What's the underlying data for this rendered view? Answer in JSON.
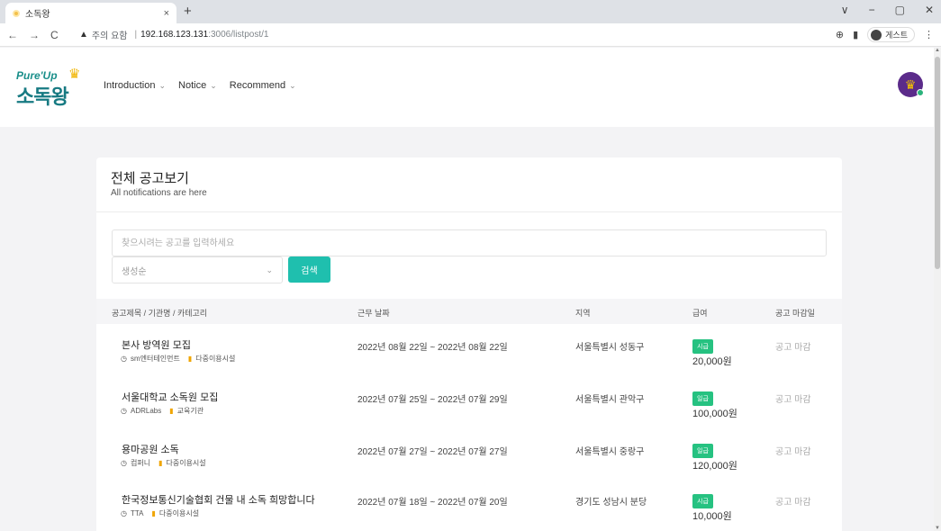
{
  "browser": {
    "tab_title": "소독왕",
    "tab_close": "×",
    "new_tab": "+",
    "nav": {
      "back": "←",
      "forward": "→",
      "reload": "C"
    },
    "address": {
      "warning": "▲",
      "insecure_label": "주의 요함",
      "separator": "|",
      "host": "192.168.123.131",
      "path": ":3006/listpost/1"
    },
    "zoom_icon": "⊕",
    "guest_label": "게스트",
    "menu": "⋮",
    "window_controls": [
      "∨",
      "−",
      "▢",
      "✕"
    ]
  },
  "site": {
    "logo": {
      "top": "Pure'Up",
      "bottom": "소독왕"
    },
    "nav": [
      {
        "label": "Introduction",
        "chevron": "⌄"
      },
      {
        "label": "Notice",
        "chevron": "⌄"
      },
      {
        "label": "Recommend",
        "chevron": "⌄"
      }
    ]
  },
  "card": {
    "title": "전체 공고보기",
    "subtitle": "All notifications are here",
    "search": {
      "placeholder": "찾으시려는 공고를 입력하세요",
      "value": ""
    },
    "sort": {
      "selected": "생성순",
      "chevron": "⌄"
    },
    "search_button": "검색",
    "columns": [
      "공고제목 / 기관명 / 카테고리",
      "근무 날짜",
      "지역",
      "급여",
      "공고 마감일"
    ],
    "rows": [
      {
        "title": "본사 방역원 모집",
        "org": "sm엔터테인먼트",
        "category": "다중이용시설",
        "date": "2022년 08월 22일 ~ 2022년 08월 22일",
        "region": "서울특별시 성동구",
        "pay_type": "시급",
        "amount": "20,000원",
        "deadline": "공고 마감"
      },
      {
        "title": "서울대학교 소독원 모집",
        "org": "ADRLabs",
        "category": "교육기관",
        "date": "2022년 07월 25일 ~ 2022년 07월 29일",
        "region": "서울특별시 관악구",
        "pay_type": "일급",
        "amount": "100,000원",
        "deadline": "공고 마감"
      },
      {
        "title": "용마공원 소독",
        "org": "컴퍼니",
        "category": "다중이용시설",
        "date": "2022년 07월 27일 ~ 2022년 07월 27일",
        "region": "서울특별시 중랑구",
        "pay_type": "일급",
        "amount": "120,000원",
        "deadline": "공고 마감"
      },
      {
        "title": "한국정보통신기술협회 건물 내 소독 희망합니다",
        "org": "TTA",
        "category": "다중이용시설",
        "date": "2022년 07월 18일 ~ 2022년 07월 20일",
        "region": "경기도 성남시 분당",
        "pay_type": "시급",
        "amount": "10,000원",
        "deadline": "공고 마감"
      }
    ]
  },
  "colors": {
    "accent": "#1fbfae",
    "pay_badge": "#26c281",
    "brand": "#177a82"
  }
}
